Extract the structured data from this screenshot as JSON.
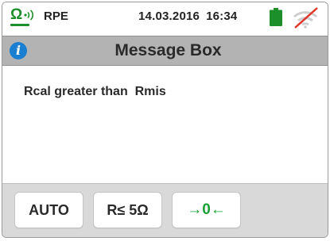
{
  "status_bar": {
    "mode_label": "RPE",
    "date": "14.03.2016",
    "time": "16:34",
    "mode_icon": "omega-signal-icon",
    "battery_icon": "battery-full-icon",
    "wireless_icon": "wifi-off-icon"
  },
  "title_bar": {
    "info_icon": "info-icon",
    "title": "Message Box"
  },
  "message": {
    "text": "Rcal greater than  Rmis"
  },
  "softkeys": {
    "auto_label": "AUTO",
    "range_label": "R≤  5Ω",
    "zero_label": "→0←"
  },
  "colors": {
    "accent_green": "#1c8f2a",
    "title_bar_bg": "#b3b3b3",
    "softkey_bar_bg": "#d9d9d9",
    "info_blue": "#1a7fd1",
    "no_signal_red": "#e0352b"
  }
}
